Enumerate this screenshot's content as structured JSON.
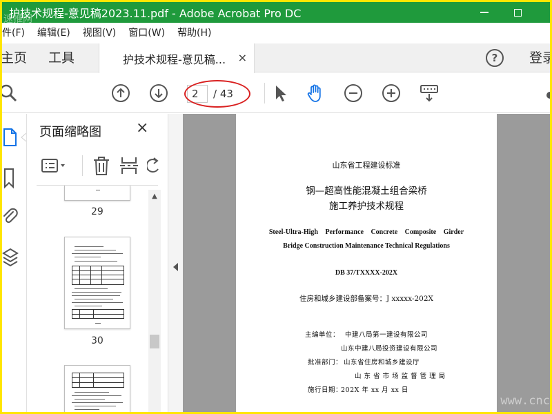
{
  "window": {
    "title": "护技术规程-意见稿2023.11.pdf - Adobe Acrobat Pro DC",
    "corner_watermark": "速推网",
    "title_bar_color": "#1f9a3c",
    "frame_color": "#ffe600"
  },
  "menubar": {
    "items": [
      "件(F)",
      "编辑(E)",
      "视图(V)",
      "窗口(W)",
      "帮助(H)"
    ]
  },
  "tabs": {
    "home": "主页",
    "tools": "工具",
    "document": "护技术规程-意见稿...",
    "close": "×",
    "help": "?",
    "signin": "登录"
  },
  "toolbar": {
    "current_page": "2",
    "total_pages": "/ 43",
    "highlight_color": "#d92020"
  },
  "thumbnail_panel": {
    "title": "页面缩略图",
    "close": "×",
    "pages": [
      "29",
      "30"
    ]
  },
  "document": {
    "standard_type": "山东省工程建设标准",
    "title_line1": "钢—超高性能混凝土组合梁桥",
    "title_line2": "施工养护技术规程",
    "english_line1": "Steel-Ultra-High Performance Concrete Composite Girder",
    "english_line2": "Bridge Construction Maintenance Technical Regulations",
    "standard_number": "DB 37/TXXXX-202X",
    "record_number": "住房和城乡建设部备案号：J xxxxx-202X",
    "editor_label": "主编单位：",
    "editor_unit1": "中建八局第一建设有限公司",
    "editor_unit2": "山东中建八局投资建设有限公司",
    "approver_label": "批准部门：",
    "approver1": "山东省住房和城乡建设厅",
    "approver2": "山 东 省 市 场 监 督 管 理 局",
    "effective_label": "施行日期：",
    "effective_date": "202X 年  xx 月  xx 日"
  },
  "watermark": "www.cnc"
}
